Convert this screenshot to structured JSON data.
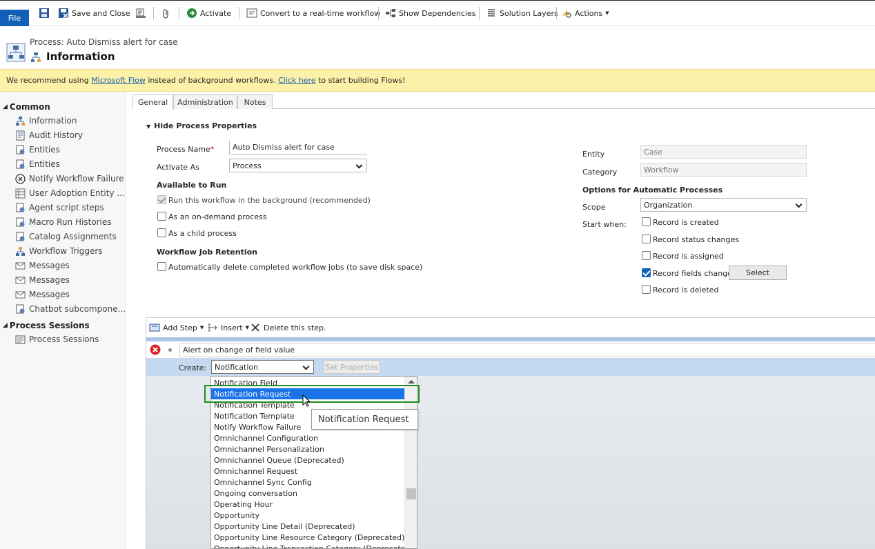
{
  "ribbon": {
    "file": "File",
    "save_close": "Save and Close",
    "activate": "Activate",
    "convert": "Convert to a real-time workflow",
    "show_dependencies": "Show Dependencies",
    "solution_layers": "Solution Layers",
    "actions": "Actions"
  },
  "header": {
    "process_label": "Process: Auto Dismiss alert for case",
    "title": "Information"
  },
  "banner": {
    "prefix": "We recommend using ",
    "link1": "Microsoft Flow",
    "middle": " instead of background workflows. ",
    "link2": "Click here",
    "suffix": " to start building Flows!"
  },
  "sidebar": {
    "common": "Common",
    "items": [
      {
        "label": "Information",
        "icon": "process-icon"
      },
      {
        "label": "Audit History",
        "icon": "audit-icon"
      },
      {
        "label": "Entities",
        "icon": "entity-icon"
      },
      {
        "label": "Entities",
        "icon": "entity-icon"
      },
      {
        "label": "Notify Workflow Failure",
        "icon": "error-circle-icon"
      },
      {
        "label": "User Adoption Entity ...",
        "icon": "grid-icon"
      },
      {
        "label": "Agent script steps",
        "icon": "entity-icon"
      },
      {
        "label": "Macro Run Histories",
        "icon": "entity-icon"
      },
      {
        "label": "Catalog Assignments",
        "icon": "entity-icon"
      },
      {
        "label": "Workflow Triggers",
        "icon": "trigger-icon"
      },
      {
        "label": "Messages",
        "icon": "envelope-icon"
      },
      {
        "label": "Messages",
        "icon": "envelope-icon"
      },
      {
        "label": "Messages",
        "icon": "envelope-icon"
      },
      {
        "label": "Chatbot subcompone...",
        "icon": "entity-icon"
      }
    ],
    "process_sessions_head": "Process Sessions",
    "process_sessions_item": "Process Sessions"
  },
  "tabs": [
    "General",
    "Administration",
    "Notes"
  ],
  "form": {
    "hide_props": "Hide Process Properties",
    "process_name_label": "Process Name",
    "process_name_value": "Auto Dismiss alert for case",
    "activate_as_label": "Activate As",
    "activate_as_value": "Process",
    "available_to_run": "Available to Run",
    "run_background": "Run this workflow in the background (recommended)",
    "on_demand": "As an on-demand process",
    "child_process": "As a child process",
    "job_retention": "Workflow Job Retention",
    "auto_delete": "Automatically delete completed workflow jobs (to save disk space)",
    "entity_label": "Entity",
    "entity_value": "Case",
    "category_label": "Category",
    "category_value": "Workflow",
    "options_auto": "Options for Automatic Processes",
    "scope_label": "Scope",
    "scope_value": "Organization",
    "start_when": "Start when:",
    "record_created": "Record is created",
    "record_status": "Record status changes",
    "record_assigned": "Record is assigned",
    "record_fields": "Record fields change",
    "select_btn": "Select",
    "record_deleted": "Record is deleted"
  },
  "designer": {
    "add_step": "Add Step",
    "insert": "Insert",
    "delete_step": "Delete this step.",
    "step_value": "Alert on change of field value",
    "create_label": "Create:",
    "create_value": "Notification",
    "set_properties": "Set Properties"
  },
  "dropdown": {
    "items": [
      "Notification Field",
      "Notification Request",
      "Notification Template",
      "Notification Template",
      "Notify Workflow Failure",
      "Omnichannel Configuration",
      "Omnichannel Personalization",
      "Omnichannel Queue (Deprecated)",
      "Omnichannel Request",
      "Omnichannel Sync Config",
      "Ongoing conversation",
      "Operating Hour",
      "Opportunity",
      "Opportunity Line Detail (Deprecated)",
      "Opportunity Line Resource Category (Deprecated)",
      "Opportunity Line Transaction Category (Deprecated)"
    ],
    "selected_index": 1,
    "tooltip": "Notification Request"
  },
  "colors": {
    "file_blue": "#1160b7",
    "banner_yellow": "#fbf1a8",
    "selected_blue": "#1a73e8",
    "highlight_green": "#1e8f1e"
  }
}
